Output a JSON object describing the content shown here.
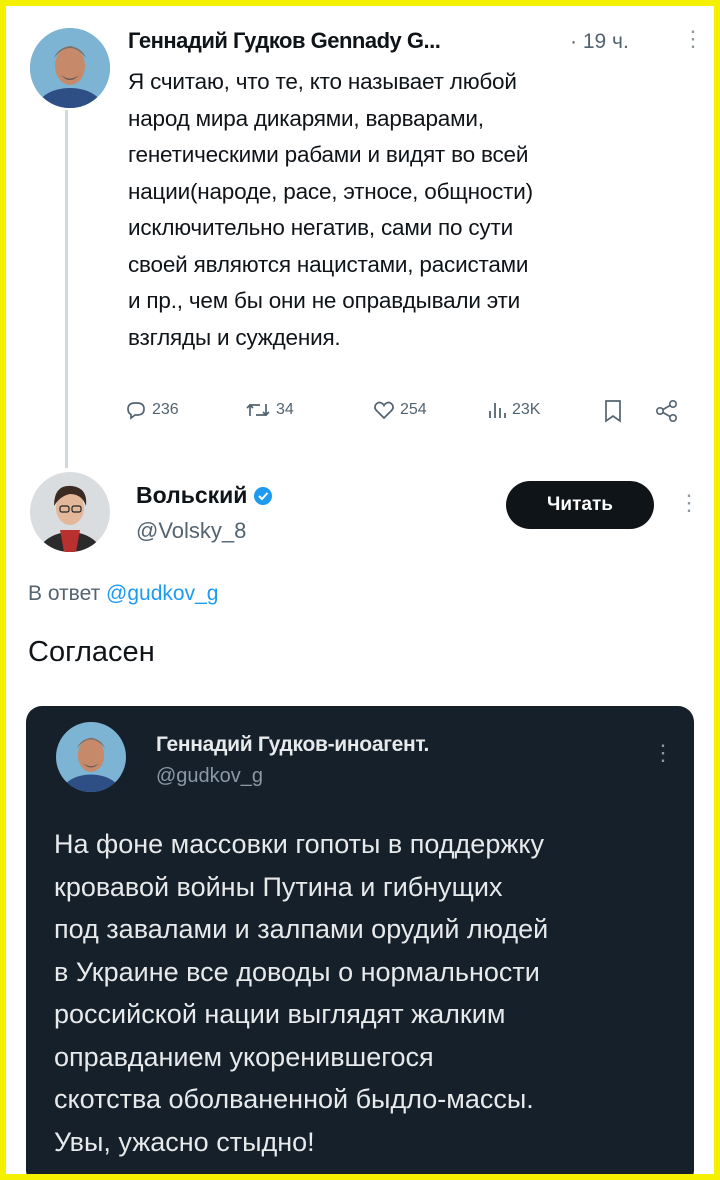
{
  "main_tweet": {
    "author_name": "Геннадий Гудков Gennady G...",
    "separator": "·",
    "time": "19 ч.",
    "text_lines": [
      "Я считаю, что те, кто называет любой",
      "народ мира дикарями, варварами,",
      "генетическими рабами и видят во всей",
      "нации(народе, расе, этносе, общности)",
      "исключительно негатив, сами по сути",
      "своей являются  нацистами, расистами",
      "и пр., чем бы они не оправдывали эти",
      "взгляды и суждения."
    ],
    "stats": {
      "replies": "236",
      "reposts": "34",
      "likes": "254",
      "views": "23K"
    }
  },
  "reply_tweet": {
    "author_name": "Вольский",
    "handle": "@Volsky_8",
    "follow_label": "Читать",
    "reply_prefix": "В ответ",
    "reply_to": "@gudkov_g",
    "text": "Согласен"
  },
  "quoted_tweet": {
    "author_name": "Геннадий Гудков-иноагент.",
    "handle": "@gudkov_g",
    "text_lines": [
      "На фоне массовки гопоты в поддержку",
      "кровавой войны Путина и гибнущих",
      "под завалами и залпами орудий людей",
      "в Украине все доводы о нормальности",
      "российской нации выглядят жалким",
      "оправданием укоренившегося",
      "скотства оболваненной быдло-массы.",
      "Увы, ужасно стыдно!"
    ]
  },
  "icons": {
    "reply": "reply-icon",
    "repost": "repost-icon",
    "like": "heart-icon",
    "views": "views-icon",
    "bookmark": "bookmark-icon",
    "share": "share-icon",
    "verified": "verified-badge-icon",
    "more": "more-vertical-icon"
  },
  "colors": {
    "frame": "#f4f000",
    "link": "#1d9bf0",
    "dark_card": "#15202b",
    "follow_button": "#0f1419"
  }
}
